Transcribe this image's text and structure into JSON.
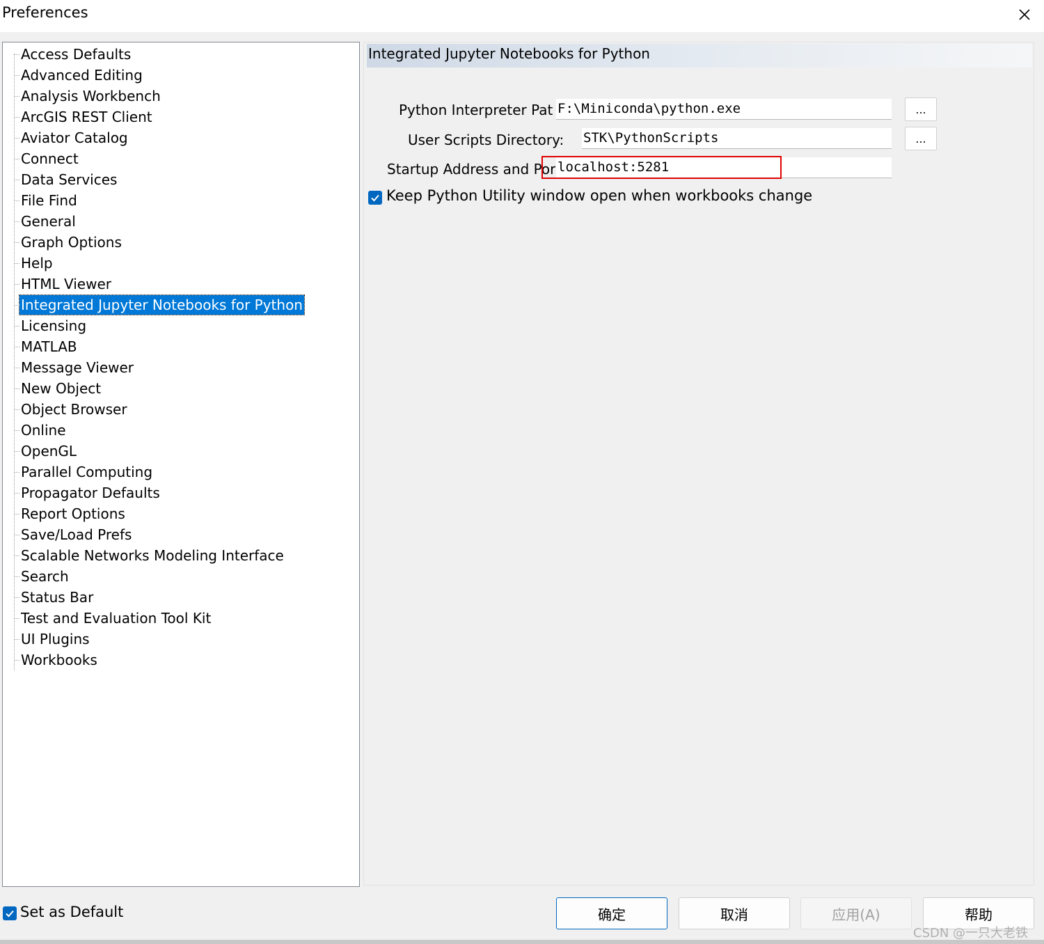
{
  "window": {
    "title": "Preferences"
  },
  "tree": {
    "items": [
      "Access Defaults",
      "Advanced Editing",
      "Analysis Workbench",
      "ArcGIS REST Client",
      "Aviator Catalog",
      "Connect",
      "Data Services",
      "File Find",
      "General",
      "Graph Options",
      "Help",
      "HTML Viewer",
      "Integrated Jupyter Notebooks for Python",
      "Licensing",
      "MATLAB",
      "Message Viewer",
      "New Object",
      "Object Browser",
      "Online",
      "OpenGL",
      "Parallel Computing",
      "Propagator Defaults",
      "Report Options",
      "Save/Load Prefs",
      "Scalable Networks Modeling Interface",
      "Search",
      "Status Bar",
      "Test and Evaluation Tool Kit",
      "UI Plugins",
      "Workbooks"
    ],
    "selected": "Integrated Jupyter Notebooks for Python"
  },
  "panel": {
    "title": "Integrated Jupyter Notebooks for Python",
    "interpreter_label": "Python Interpreter Pat",
    "interpreter_value": "F:\\Miniconda\\python.exe",
    "scripts_label": "User Scripts Directory:",
    "scripts_value": "STK\\PythonScripts",
    "startup_label": "Startup Address and Por",
    "startup_value": "localhost:5281",
    "browse_label": "...",
    "keep_open_label": "Keep Python Utility window open when workbooks change",
    "keep_open_checked": true
  },
  "footer": {
    "set_default_label": "Set as Default",
    "set_default_checked": true,
    "ok_label": "确定",
    "cancel_label": "取消",
    "apply_label": "应用(A)",
    "help_label": "帮助"
  },
  "watermark": "CSDN @一只大老铁",
  "colors": {
    "selection": "#0078d7",
    "checkbox": "#0067c0",
    "highlight": "#e00000"
  }
}
